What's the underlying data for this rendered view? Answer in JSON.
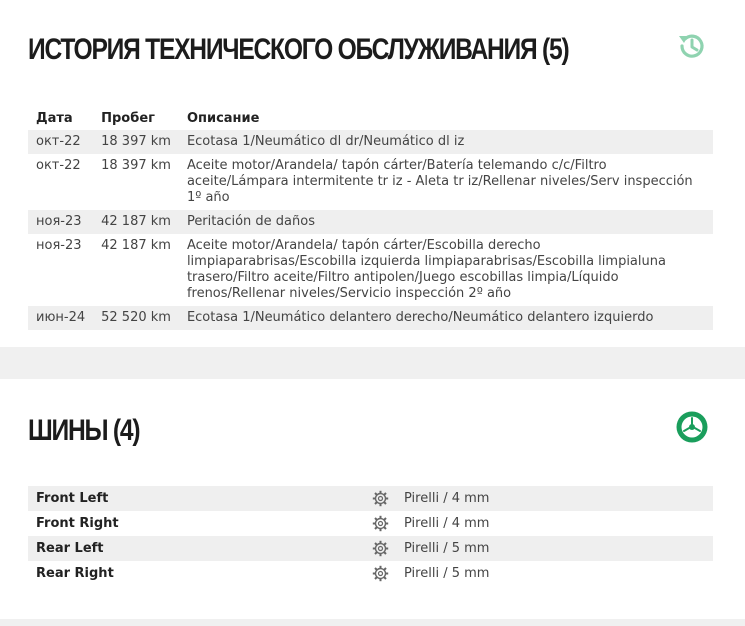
{
  "maintenance": {
    "title": "ИСТОРИЯ ТЕХНИЧЕСКОГО ОБСЛУЖИВАНИЯ (5)",
    "icon": "history-icon",
    "columns": {
      "date": "Дата",
      "mileage": "Пробег",
      "description": "Описание"
    },
    "rows": [
      {
        "date": "окт-22",
        "mileage": "18 397 km",
        "description": "Ecotasa 1/Neumático dl dr/Neumático dl iz"
      },
      {
        "date": "окт-22",
        "mileage": "18 397 km",
        "description": "Aceite motor/Arandela/ tapón cárter/Batería telemando c/c/Filtro aceite/Lámpara intermitente tr iz - Aleta tr iz/Rellenar niveles/Serv inspección 1º año"
      },
      {
        "date": "ноя-23",
        "mileage": "42 187 km",
        "description": "Peritación de daños"
      },
      {
        "date": "ноя-23",
        "mileage": "42 187 km",
        "description": "Aceite motor/Arandela/ tapón cárter/Escobilla derecho limpiaparabrisas/Escobilla izquierda limpiaparabrisas/Escobilla limpialuna trasero/Filtro aceite/Filtro antipolen/Juego escobillas limpia/Líquido frenos/Rellenar niveles/Servicio inspección 2º año"
      },
      {
        "date": "июн-24",
        "mileage": "52 520 km",
        "description": "Ecotasa 1/Neumático delantero derecho/Neumático delantero izquierdo"
      }
    ]
  },
  "tires": {
    "title": "ШИНЫ (4)",
    "icon": "tire-icon",
    "rows": [
      {
        "position": "Front Left",
        "value": "Pirelli / 4 mm",
        "icon": "gear-icon"
      },
      {
        "position": "Front Right",
        "value": "Pirelli / 4 mm",
        "icon": "gear-icon"
      },
      {
        "position": "Rear Left",
        "value": "Pirelli / 5 mm",
        "icon": "gear-icon"
      },
      {
        "position": "Rear Right",
        "value": "Pirelli / 5 mm",
        "icon": "gear-icon"
      }
    ]
  },
  "colors": {
    "accent": "#1a9e5c",
    "accent_light": "#8fd3b0",
    "row_shade": "#efefef",
    "divider": "#f0f0f0"
  }
}
